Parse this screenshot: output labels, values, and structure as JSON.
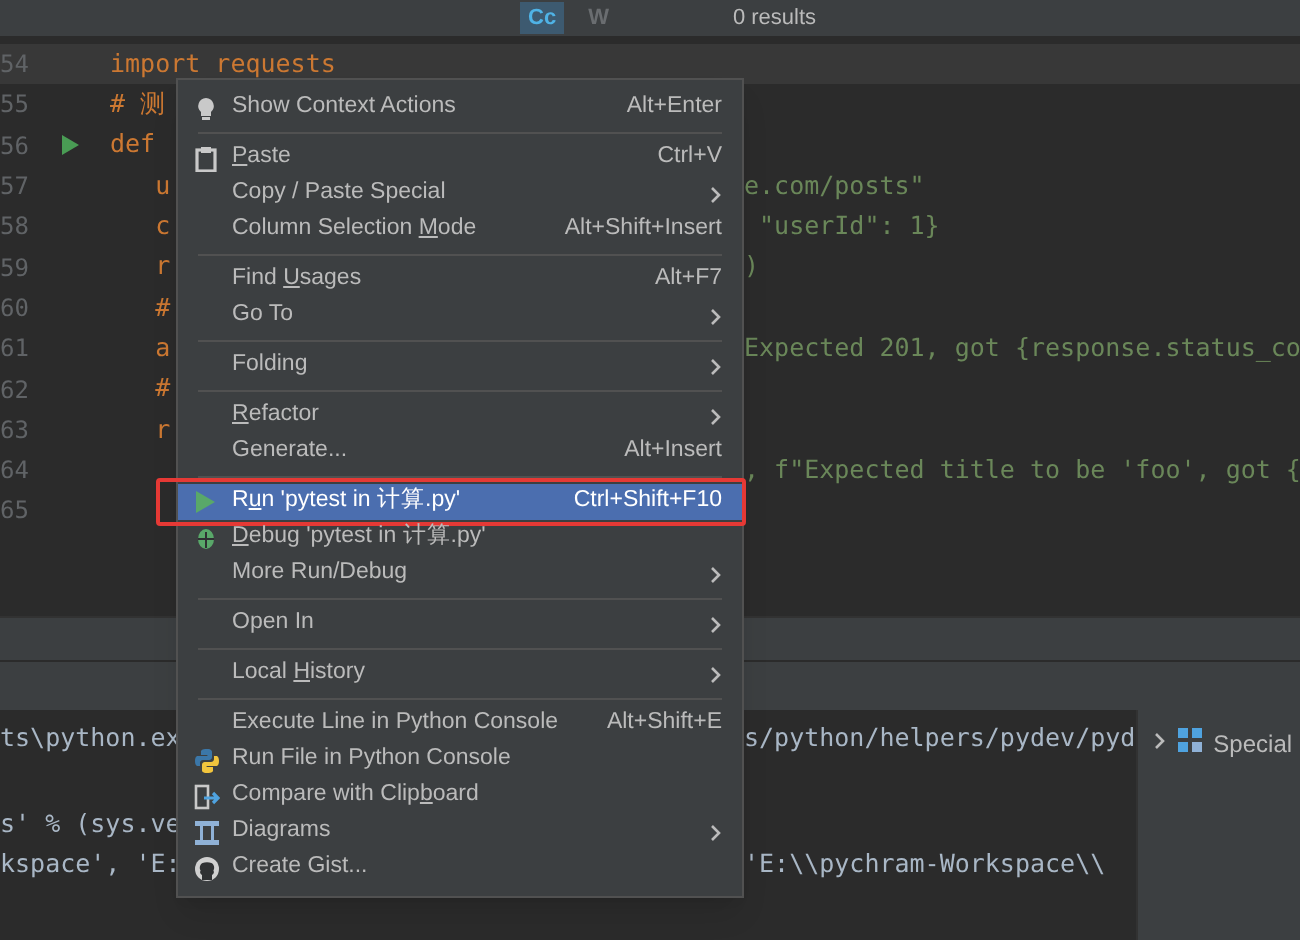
{
  "find_bar": {
    "match_case": "Cc",
    "words": "W",
    "results": "0 results"
  },
  "editor": {
    "lines": [
      {
        "number": "54",
        "left": "import requests",
        "current": true
      },
      {
        "number": "55",
        "left": "# 测",
        "current": false
      },
      {
        "number": "56",
        "left": "def",
        "runnable": true,
        "current": false
      },
      {
        "number": "57",
        "left": "   u",
        "right": "e.com/posts\"",
        "current": false
      },
      {
        "number": "58",
        "left": "   c",
        "right": " \"userId\": 1}",
        "current": false
      },
      {
        "number": "59",
        "left": "   r",
        "right": ")",
        "current": false
      },
      {
        "number": "60",
        "left": "   #",
        "current": false
      },
      {
        "number": "61",
        "left": "   a",
        "right": "Expected 201, got {response.status_co",
        "current": false
      },
      {
        "number": "62",
        "left": "   #",
        "current": false
      },
      {
        "number": "63",
        "left": "   r",
        "current": false
      },
      {
        "number": "64",
        "right": ", f\"Expected title to be 'foo', got {",
        "current": false
      },
      {
        "number": "65",
        "current": false
      }
    ]
  },
  "console": {
    "lines": [
      {
        "left": "ts\\python.ex",
        "right": "s/python/helpers/pydev/pyd"
      },
      {
        "left": "s' % (sys.ve"
      },
      {
        "left": "kspace', 'E:",
        "right": "'E:\\\\pychram-Workspace\\\\"
      }
    ],
    "side_panel": {
      "label": "Special"
    }
  },
  "context_menu": {
    "items": [
      {
        "kind": "item",
        "label": "Show Context Actions",
        "shortcut": "Alt+Enter",
        "submenu": false,
        "selected": false,
        "outlined": false
      },
      {
        "kind": "separator"
      },
      {
        "kind": "item",
        "mnemonic_label": {
          "key": "P",
          "after": "aste"
        },
        "shortcut": "Ctrl+V",
        "submenu": false,
        "selected": false,
        "outlined": false
      },
      {
        "kind": "item",
        "label": "Copy / Paste Special",
        "submenu": true,
        "selected": false,
        "outlined": false
      },
      {
        "kind": "item",
        "mnemonic_label": {
          "before": "Column Selection ",
          "key": "M",
          "after": "ode"
        },
        "shortcut": "Alt+Shift+Insert",
        "submenu": false,
        "selected": false,
        "outlined": false
      },
      {
        "kind": "separator"
      },
      {
        "kind": "item",
        "mnemonic_label": {
          "before": "Find ",
          "key": "U",
          "after": "sages"
        },
        "shortcut": "Alt+F7",
        "submenu": false,
        "selected": false,
        "outlined": false
      },
      {
        "kind": "item",
        "label": "Go To",
        "submenu": true,
        "selected": false,
        "outlined": false
      },
      {
        "kind": "separator"
      },
      {
        "kind": "item",
        "label": "Folding",
        "submenu": true,
        "selected": false,
        "outlined": false
      },
      {
        "kind": "separator"
      },
      {
        "kind": "item",
        "mnemonic_label": {
          "key": "R",
          "after": "efactor"
        },
        "submenu": true,
        "selected": false,
        "outlined": false
      },
      {
        "kind": "item",
        "label": "Generate...",
        "shortcut": "Alt+Insert",
        "submenu": false,
        "selected": false,
        "outlined": false
      },
      {
        "kind": "separator"
      },
      {
        "kind": "item",
        "mnemonic_label": {
          "before": "R",
          "key": "u",
          "after": "n 'pytest in 计算.py'"
        },
        "shortcut": "Ctrl+Shift+F10",
        "submenu": false,
        "selected": true,
        "outlined": true
      },
      {
        "kind": "item",
        "mnemonic_label": {
          "key": "D",
          "after": "ebug 'pytest in 计算.py'"
        },
        "submenu": false,
        "selected": false,
        "outlined": false
      },
      {
        "kind": "item",
        "label": "More Run/Debug",
        "submenu": true,
        "selected": false,
        "outlined": false
      },
      {
        "kind": "separator"
      },
      {
        "kind": "item",
        "label": "Open In",
        "submenu": true,
        "selected": false,
        "outlined": false
      },
      {
        "kind": "separator"
      },
      {
        "kind": "item",
        "mnemonic_label": {
          "before": "Local ",
          "key": "H",
          "after": "istory"
        },
        "submenu": true,
        "selected": false,
        "outlined": false
      },
      {
        "kind": "separator"
      },
      {
        "kind": "item",
        "label": "Execute Line in Python Console",
        "shortcut": "Alt+Shift+E",
        "submenu": false,
        "selected": false,
        "outlined": false
      },
      {
        "kind": "item",
        "label": "Run File in Python Console",
        "submenu": false,
        "selected": false,
        "outlined": false
      },
      {
        "kind": "item",
        "mnemonic_label": {
          "before": "Compare with Clip",
          "key": "b",
          "after": "oard"
        },
        "submenu": false,
        "selected": false,
        "outlined": false
      },
      {
        "kind": "item",
        "label": "Diagrams",
        "submenu": true,
        "selected": false,
        "outlined": false
      },
      {
        "kind": "item",
        "label": "Create Gist...",
        "submenu": false,
        "selected": false,
        "outlined": false
      }
    ]
  }
}
